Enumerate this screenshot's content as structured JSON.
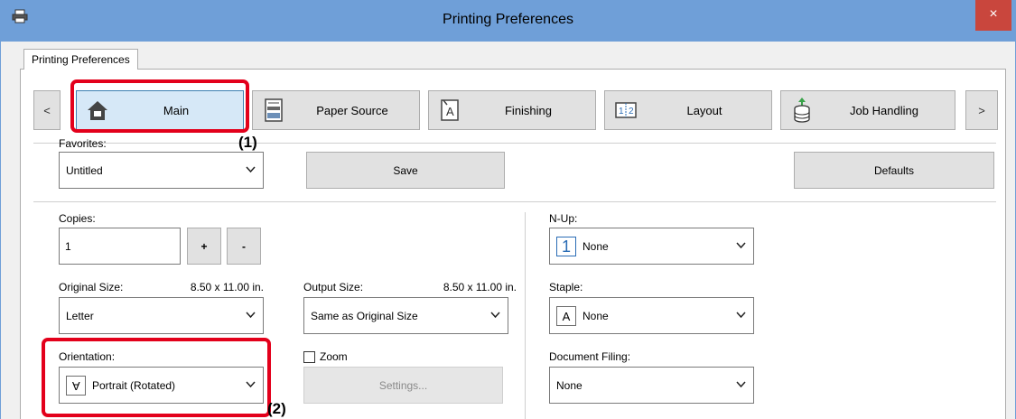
{
  "window": {
    "title": "Printing Preferences",
    "close_glyph": "×",
    "app_icon": "printer-icon"
  },
  "outer_tab": {
    "label": "Printing Preferences"
  },
  "nav": {
    "prev": "<",
    "next": ">",
    "tabs": [
      {
        "label": "Main",
        "icon": "house-icon",
        "selected": true
      },
      {
        "label": "Paper Source",
        "icon": "paper-tray-icon",
        "selected": false
      },
      {
        "label": "Finishing",
        "icon": "finishing-icon",
        "selected": false
      },
      {
        "label": "Layout",
        "icon": "layout-icon",
        "selected": false
      },
      {
        "label": "Job Handling",
        "icon": "job-handling-icon",
        "selected": false
      }
    ]
  },
  "favorites": {
    "label": "Favorites:",
    "value": "Untitled",
    "save_label": "Save",
    "defaults_label": "Defaults"
  },
  "copies": {
    "label": "Copies:",
    "value": "1",
    "plus": "+",
    "minus": "-"
  },
  "original_size": {
    "label": "Original Size:",
    "dimension": "8.50 x 11.00 in.",
    "value": "Letter"
  },
  "output_size": {
    "label": "Output Size:",
    "dimension": "8.50 x 11.00 in.",
    "value": "Same as Original Size"
  },
  "orientation": {
    "label": "Orientation:",
    "value": "Portrait (Rotated)",
    "icon_glyph": "A"
  },
  "zoom": {
    "label": "Zoom",
    "checked": false,
    "settings_label": "Settings..."
  },
  "nup": {
    "label": "N-Up:",
    "value": "None",
    "icon_glyph": "1"
  },
  "staple": {
    "label": "Staple:",
    "value": "None",
    "icon_glyph": "A"
  },
  "document_filing": {
    "label": "Document Filing:",
    "value": "None"
  },
  "callouts": {
    "one": "(1)",
    "two": "(2)"
  },
  "colors": {
    "titlebar": "#6f9fd8",
    "close": "#c9463d",
    "highlight": "#e3001b",
    "selected_tab": "#d6e8f7"
  }
}
